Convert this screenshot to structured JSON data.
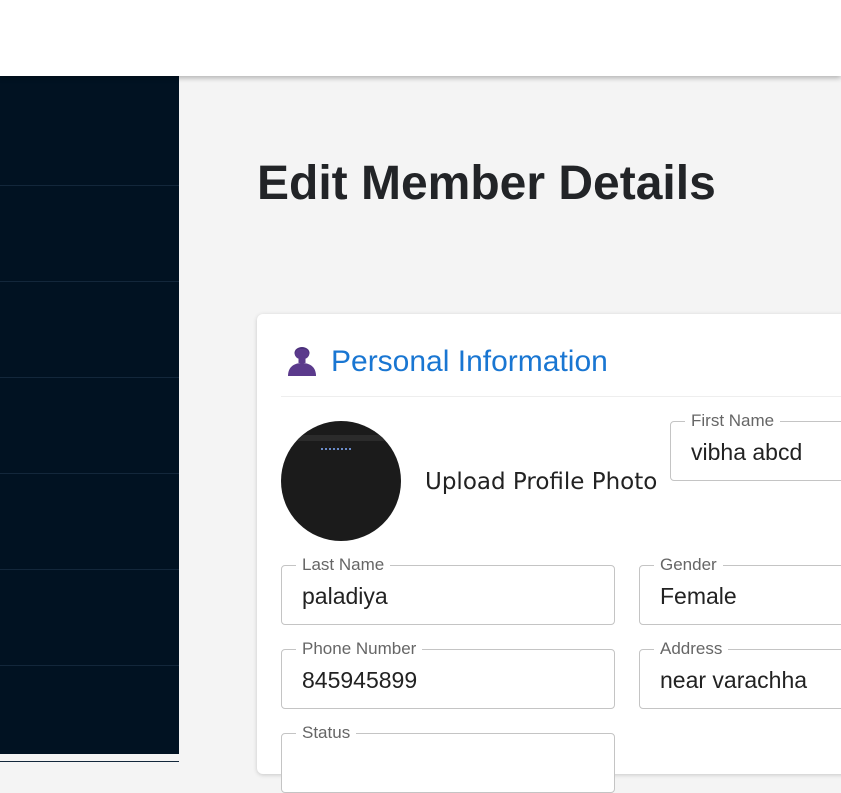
{
  "page": {
    "title": "Edit Member Details"
  },
  "section": {
    "title": "Personal Information",
    "icon": "person-icon"
  },
  "profile": {
    "upload_label": "Upload Profile Photo"
  },
  "fields": {
    "first_name": {
      "label": "First Name",
      "value": "vibha abcd"
    },
    "last_name": {
      "label": "Last Name",
      "value": "paladiya"
    },
    "gender": {
      "label": "Gender",
      "value": "Female"
    },
    "phone": {
      "label": "Phone Number",
      "value": "845945899"
    },
    "address": {
      "label": "Address",
      "value": "near varachha"
    },
    "status": {
      "label": "Status",
      "value": ""
    }
  },
  "colors": {
    "sidebar": "#011222",
    "accent": "#1976d2",
    "icon": "#5b3a8c"
  }
}
